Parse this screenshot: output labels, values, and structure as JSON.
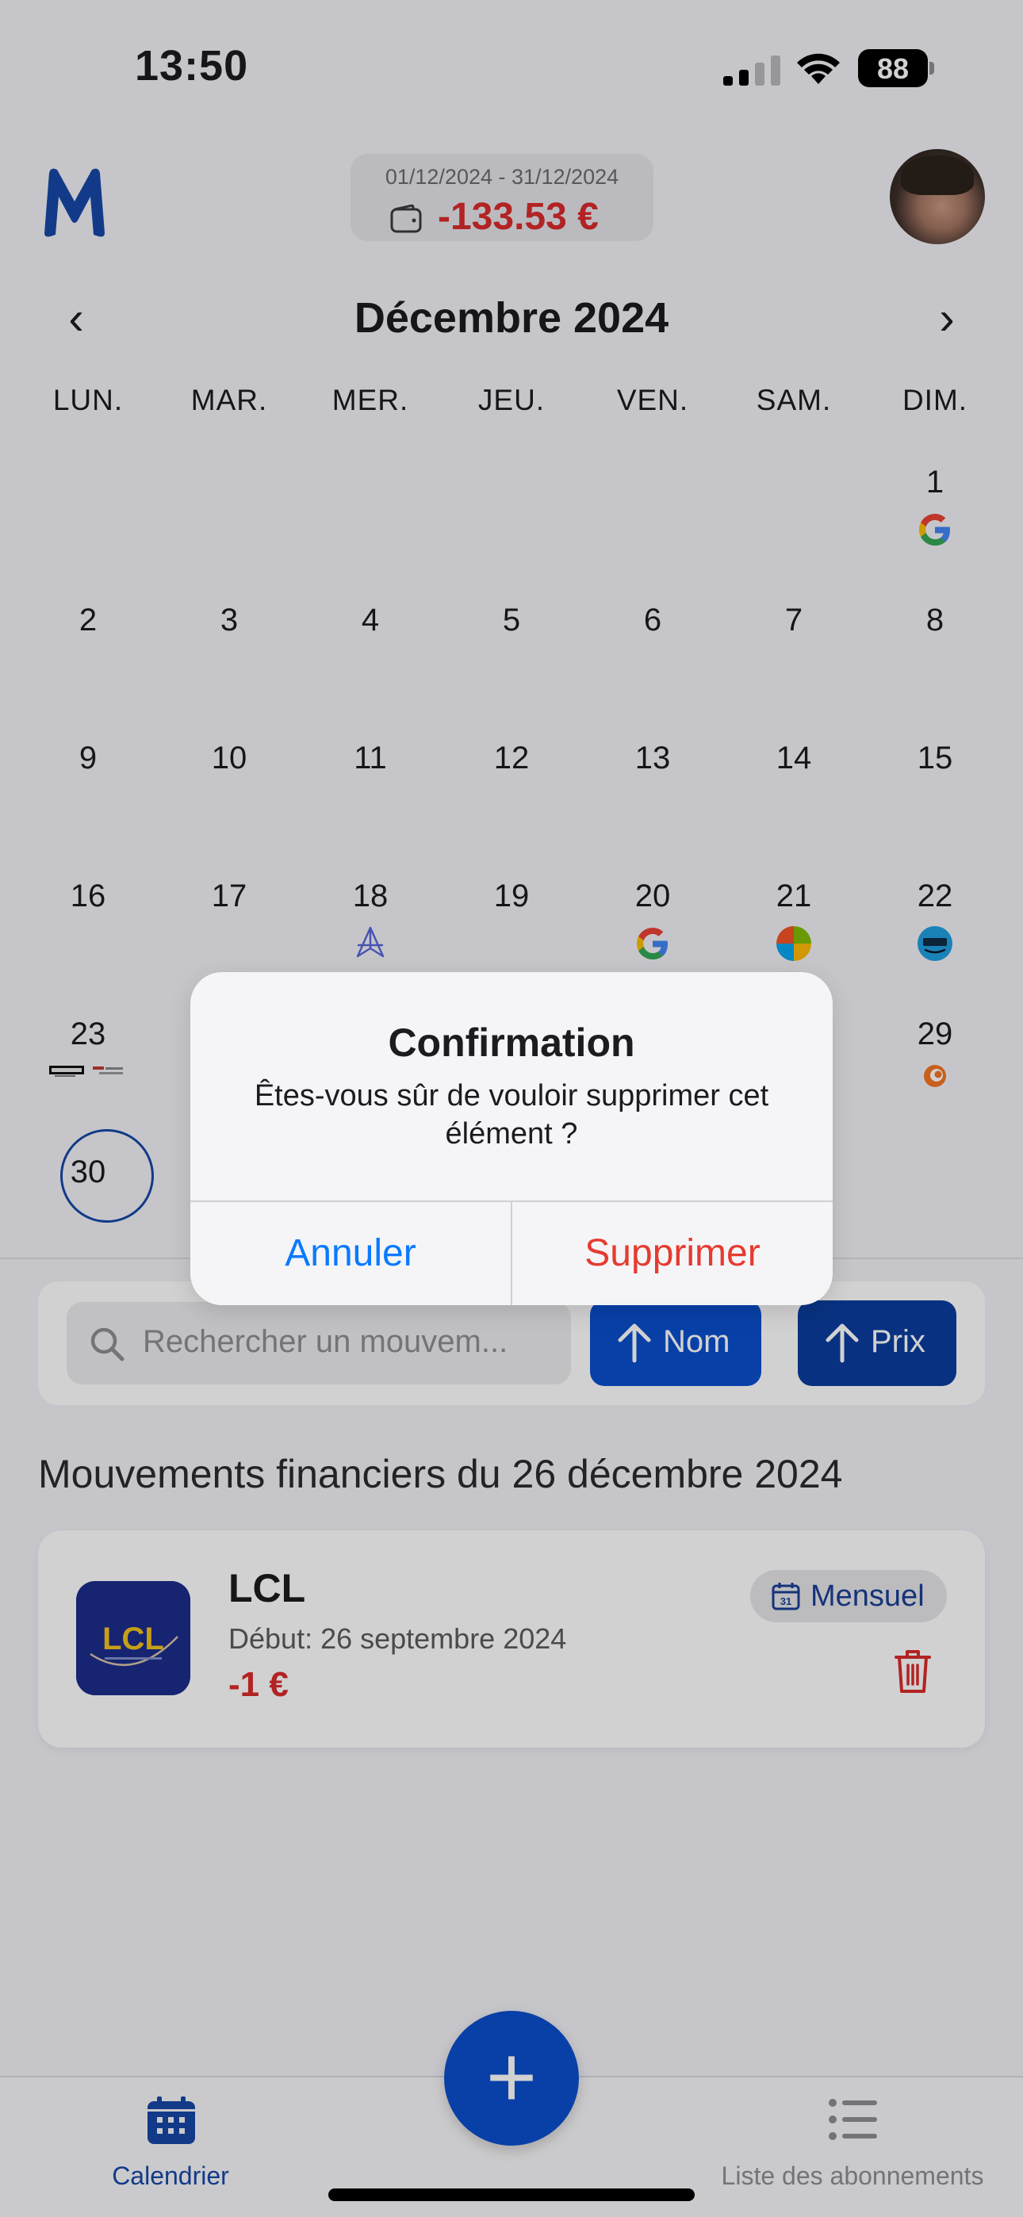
{
  "status_bar": {
    "time": "13:50",
    "battery": "88"
  },
  "header": {
    "logo": "M",
    "period_range": "01/12/2024 - 31/12/2024",
    "period_total": "-133.53 €"
  },
  "calendar": {
    "month": "Décembre 2024",
    "weekdays": [
      "LUN.",
      "MAR.",
      "MER.",
      "JEU.",
      "VEN.",
      "SAM.",
      "DIM."
    ],
    "days": [
      {
        "n": "1",
        "icons": [
          "google-icon"
        ]
      },
      {
        "n": "2",
        "icons": []
      },
      {
        "n": "3",
        "icons": []
      },
      {
        "n": "4",
        "icons": []
      },
      {
        "n": "5",
        "icons": []
      },
      {
        "n": "6",
        "icons": []
      },
      {
        "n": "7",
        "icons": []
      },
      {
        "n": "8",
        "icons": []
      },
      {
        "n": "9",
        "icons": []
      },
      {
        "n": "10",
        "icons": []
      },
      {
        "n": "11",
        "icons": []
      },
      {
        "n": "12",
        "icons": []
      },
      {
        "n": "13",
        "icons": []
      },
      {
        "n": "14",
        "icons": []
      },
      {
        "n": "15",
        "icons": []
      },
      {
        "n": "16",
        "icons": []
      },
      {
        "n": "17",
        "icons": []
      },
      {
        "n": "18",
        "icons": [
          "perplexity-icon"
        ]
      },
      {
        "n": "19",
        "icons": []
      },
      {
        "n": "20",
        "icons": [
          "google-icon"
        ]
      },
      {
        "n": "21",
        "icons": [
          "microsoft-icon"
        ]
      },
      {
        "n": "22",
        "icons": [
          "prime-icon"
        ]
      },
      {
        "n": "23",
        "icons": [
          "canal-plus-icon",
          "canal-plus-alt-icon"
        ]
      },
      {
        "n": "29",
        "icons": [
          "crunchyroll-icon"
        ]
      },
      {
        "n": "30",
        "icons": [],
        "today": true
      }
    ]
  },
  "search": {
    "placeholder": "Rechercher un mouvem...",
    "sort_name": "Nom",
    "sort_price": "Prix"
  },
  "section_title": "Mouvements financiers du 26 décembre 2024",
  "movement": {
    "name": "LCL",
    "start": "Début: 26 septembre 2024",
    "amount": "-1 €",
    "frequency": "Mensuel",
    "logo_text": "LCL",
    "calendar_badge_day": "31"
  },
  "tabbar": {
    "calendar_label": "Calendrier",
    "list_label": "Liste des abonnements",
    "fab_symbol": "+"
  },
  "alert": {
    "title": "Confirmation",
    "message": "Êtes-vous sûr de vouloir supprimer cet élément ?",
    "cancel": "Annuler",
    "confirm": "Supprimer"
  },
  "colors": {
    "accent": "#0a4fcc",
    "negative": "#d92b2b",
    "alert_cancel": "#0a7aff",
    "alert_destructive": "#e53b30"
  }
}
